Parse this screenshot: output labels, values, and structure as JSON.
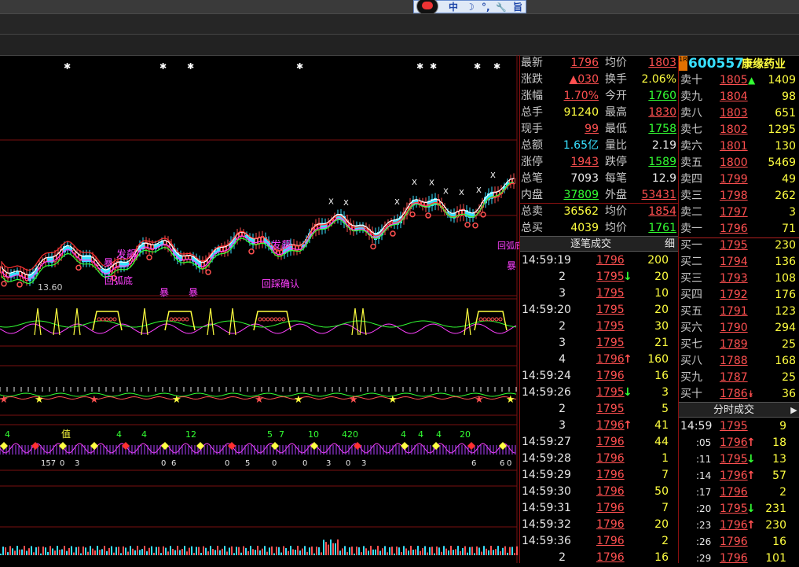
{
  "ime_bar": {
    "chars": [
      "中",
      "☽",
      "°,",
      "🔧",
      "旨"
    ]
  },
  "stock": {
    "badge": "1R",
    "code": "600557",
    "name": "康缘药业"
  },
  "quote": [
    {
      "l1": "最新",
      "v1": "1796",
      "c1": "red",
      "l2": "均价",
      "v2": "1803",
      "c2": "red"
    },
    {
      "l1": "涨跌",
      "v1": "▲030",
      "c1": "red",
      "l2": "换手",
      "v2": "2.06%",
      "c2": "yel"
    },
    {
      "l1": "涨幅",
      "v1": "1.70%",
      "c1": "red",
      "l2": "今开",
      "v2": "1760",
      "c2": "grn"
    },
    {
      "l1": "总手",
      "v1": "91240",
      "c1": "yel",
      "l2": "最高",
      "v2": "1830",
      "c2": "red"
    },
    {
      "l1": "现手",
      "v1": "99",
      "c1": "red",
      "l2": "最低",
      "v2": "1758",
      "c2": "grn"
    },
    {
      "l1": "总额",
      "v1": "1.65亿",
      "c1": "cyn",
      "l2": "量比",
      "v2": "2.19",
      "c2": "wht"
    },
    {
      "l1": "涨停",
      "v1": "1943",
      "c1": "red",
      "l2": "跌停",
      "v2": "1589",
      "c2": "grn"
    },
    {
      "l1": "总笔",
      "v1": "7093",
      "c1": "wht",
      "l2": "每笔",
      "v2": "12.9",
      "c2": "wht"
    },
    {
      "l1": "内盘",
      "v1": "37809",
      "c1": "grn",
      "l2": "外盘",
      "v2": "53431",
      "c2": "red"
    },
    {
      "l1": "总卖",
      "v1": "36562",
      "c1": "yel",
      "l2": "均价",
      "v2": "1854",
      "c2": "red"
    },
    {
      "l1": "总买",
      "v1": "4039",
      "c1": "yel",
      "l2": "均价",
      "v2": "1761",
      "c2": "grn"
    }
  ],
  "orderbook": {
    "asks": [
      {
        "label": "卖十",
        "price": "1805",
        "vol": "1409",
        "arrow": "▲"
      },
      {
        "label": "卖九",
        "price": "1804",
        "vol": "98",
        "arrow": ""
      },
      {
        "label": "卖八",
        "price": "1803",
        "vol": "651",
        "arrow": ""
      },
      {
        "label": "卖七",
        "price": "1802",
        "vol": "1295",
        "arrow": ""
      },
      {
        "label": "卖六",
        "price": "1801",
        "vol": "130",
        "arrow": ""
      },
      {
        "label": "卖五",
        "price": "1800",
        "vol": "5469",
        "arrow": ""
      },
      {
        "label": "卖四",
        "price": "1799",
        "vol": "49",
        "arrow": ""
      },
      {
        "label": "卖三",
        "price": "1798",
        "vol": "262",
        "arrow": ""
      },
      {
        "label": "卖二",
        "price": "1797",
        "vol": "3",
        "arrow": ""
      },
      {
        "label": "卖一",
        "price": "1796",
        "vol": "71",
        "arrow": ""
      }
    ],
    "bids": [
      {
        "label": "买一",
        "price": "1795",
        "vol": "230",
        "arrow": ""
      },
      {
        "label": "买二",
        "price": "1794",
        "vol": "136",
        "arrow": ""
      },
      {
        "label": "买三",
        "price": "1793",
        "vol": "108",
        "arrow": ""
      },
      {
        "label": "买四",
        "price": "1792",
        "vol": "176",
        "arrow": ""
      },
      {
        "label": "买五",
        "price": "1791",
        "vol": "123",
        "arrow": ""
      },
      {
        "label": "买六",
        "price": "1790",
        "vol": "294",
        "arrow": ""
      },
      {
        "label": "买七",
        "price": "1789",
        "vol": "25",
        "arrow": ""
      },
      {
        "label": "买八",
        "price": "1788",
        "vol": "168",
        "arrow": ""
      },
      {
        "label": "买九",
        "price": "1787",
        "vol": "25",
        "arrow": ""
      },
      {
        "label": "买十",
        "price": "1786",
        "vol": "36",
        "arrow": "⯯"
      }
    ]
  },
  "ticks_panel": {
    "title": "逐笔成交",
    "detail_button": "细",
    "rows": [
      {
        "time": "14:59:19",
        "price": "1796",
        "arrow": "",
        "vol": "200"
      },
      {
        "time": "2",
        "price": "1795",
        "arrow": "↓",
        "vol": "20"
      },
      {
        "time": "3",
        "price": "1795",
        "arrow": "",
        "vol": "10"
      },
      {
        "time": "14:59:20",
        "price": "1795",
        "arrow": "",
        "vol": "20"
      },
      {
        "time": "2",
        "price": "1795",
        "arrow": "",
        "vol": "30"
      },
      {
        "time": "3",
        "price": "1795",
        "arrow": "",
        "vol": "21"
      },
      {
        "time": "4",
        "price": "1796",
        "arrow": "↑",
        "vol": "160"
      },
      {
        "time": "14:59:24",
        "price": "1796",
        "arrow": "",
        "vol": "16"
      },
      {
        "time": "14:59:26",
        "price": "1795",
        "arrow": "↓",
        "vol": "3"
      },
      {
        "time": "2",
        "price": "1795",
        "arrow": "",
        "vol": "5"
      },
      {
        "time": "3",
        "price": "1796",
        "arrow": "↑",
        "vol": "41"
      },
      {
        "time": "14:59:27",
        "price": "1796",
        "arrow": "",
        "vol": "44"
      },
      {
        "time": "14:59:28",
        "price": "1796",
        "arrow": "",
        "vol": "1"
      },
      {
        "time": "14:59:29",
        "price": "1796",
        "arrow": "",
        "vol": "7"
      },
      {
        "time": "14:59:30",
        "price": "1796",
        "arrow": "",
        "vol": "50"
      },
      {
        "time": "14:59:31",
        "price": "1796",
        "arrow": "",
        "vol": "7"
      },
      {
        "time": "14:59:32",
        "price": "1796",
        "arrow": "",
        "vol": "20"
      },
      {
        "time": "14:59:36",
        "price": "1796",
        "arrow": "",
        "vol": "2"
      },
      {
        "time": "2",
        "price": "1796",
        "arrow": "",
        "vol": "16"
      }
    ]
  },
  "minute_panel": {
    "title": "分时成交",
    "scroll_label": "▶",
    "rows": [
      {
        "time": "14:59",
        "price": "1795",
        "arrow": "",
        "vol": "9"
      },
      {
        "time": ":05",
        "price": "1796",
        "arrow": "↑",
        "vol": "18"
      },
      {
        "time": ":11",
        "price": "1795",
        "arrow": "↓",
        "vol": "13"
      },
      {
        "time": ":14",
        "price": "1796",
        "arrow": "↑",
        "vol": "57"
      },
      {
        "time": ":17",
        "price": "1796",
        "arrow": "",
        "vol": "2"
      },
      {
        "time": ":20",
        "price": "1795",
        "arrow": "↓",
        "vol": "231"
      },
      {
        "time": ":23",
        "price": "1796",
        "arrow": "↑",
        "vol": "230"
      },
      {
        "time": ":26",
        "price": "1796",
        "arrow": "",
        "vol": "16"
      },
      {
        "time": ":29",
        "price": "1796",
        "arrow": "",
        "vol": "101"
      }
    ]
  },
  "chart_labels": {
    "price_low": "13.60",
    "signals": [
      "发飙",
      "发飙",
      "暴",
      "暴",
      "暴",
      "暴",
      "回弧底",
      "回踩确认",
      "回弧底"
    ],
    "ind4_numbers": [
      "4",
      "4",
      "4",
      "12",
      "5",
      "7",
      "10",
      "420",
      "4",
      "4",
      "4",
      "20"
    ],
    "ind4_bottom": [
      "157",
      "0",
      "3",
      "0",
      "6",
      "0",
      "5",
      "0",
      "0",
      "3",
      "0",
      "3",
      "6",
      "6",
      "0"
    ],
    "ind4_tag": "值"
  },
  "colors": {
    "red": "#ff5050",
    "green": "#33ff33",
    "yellow": "#ffff40",
    "cyan": "#38e0ff",
    "magenta": "#ff40ff"
  }
}
